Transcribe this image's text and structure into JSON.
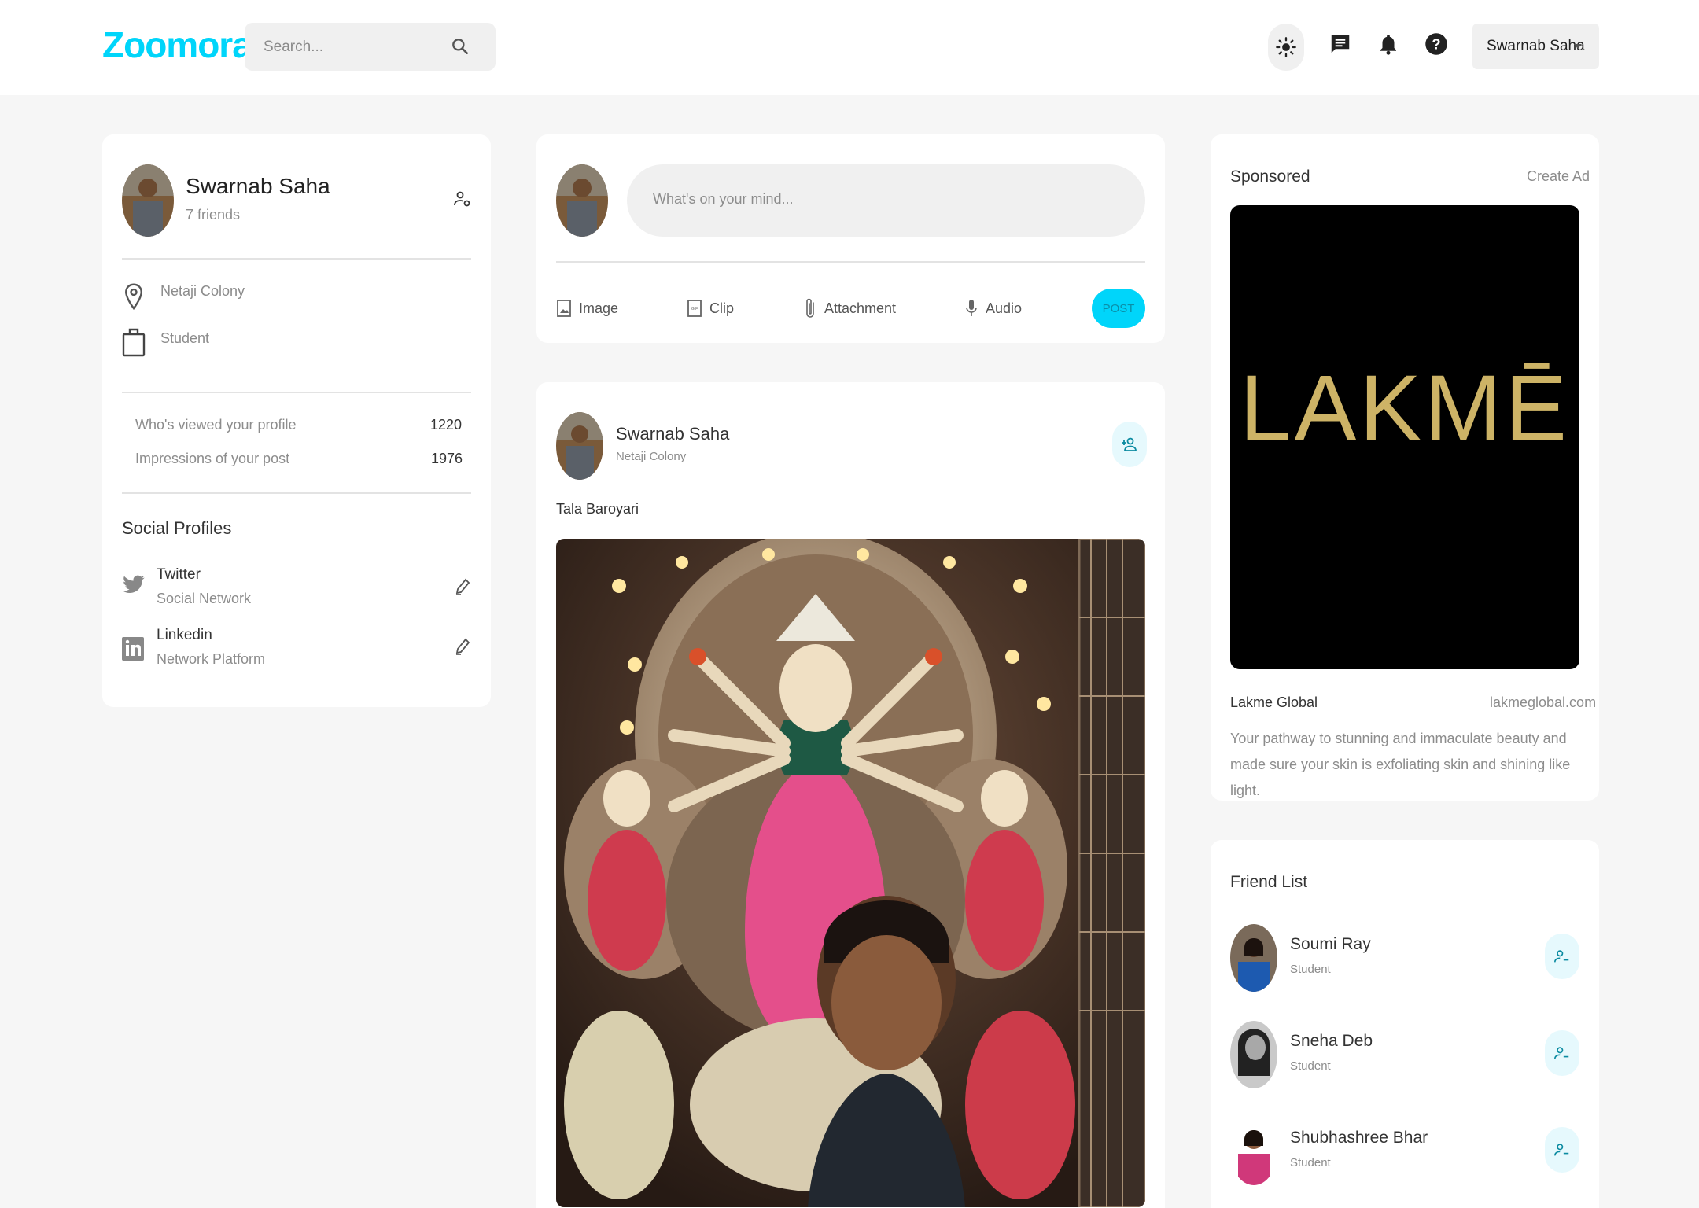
{
  "nav": {
    "logo": "Zoomora",
    "search_placeholder": "Search...",
    "user_name": "Swarnab Saha",
    "icons": [
      "search-icon",
      "light-mode-icon",
      "message-icon",
      "notification-icon",
      "help-icon",
      "chevron-down-icon"
    ]
  },
  "profile": {
    "name": "Swarnab Saha",
    "friends": "7 friends",
    "location": "Netaji Colony",
    "occupation": "Student",
    "stats": [
      {
        "label": "Who's viewed your profile",
        "value": "1220"
      },
      {
        "label": "Impressions of your post",
        "value": "1976"
      }
    ],
    "social_title": "Social Profiles",
    "socials": [
      {
        "name": "Twitter",
        "type": "Social Network",
        "icon": "twitter-icon"
      },
      {
        "name": "Linkedin",
        "type": "Network Platform",
        "icon": "linkedin-icon"
      }
    ]
  },
  "composer": {
    "placeholder": "What's on your mind...",
    "actions": [
      {
        "label": "Image",
        "icon": "image-icon"
      },
      {
        "label": "Clip",
        "icon": "gif-icon"
      },
      {
        "label": "Attachment",
        "icon": "attachment-icon"
      },
      {
        "label": "Audio",
        "icon": "microphone-icon"
      }
    ],
    "post_label": "POST"
  },
  "post": {
    "author": "Swarnab Saha",
    "location": "Netaji Colony",
    "caption": "Tala Baroyari"
  },
  "sponsored": {
    "title": "Sponsored",
    "create_ad": "Create Ad",
    "brand_logo_text": "LAKMĒ",
    "brand": "Lakme Global",
    "url": "lakmeglobal.com",
    "description": "Your pathway to stunning and immaculate beauty and made sure your skin is exfoliating skin and shining like light."
  },
  "friends": {
    "title": "Friend List",
    "items": [
      {
        "name": "Soumi Ray",
        "occupation": "Student"
      },
      {
        "name": "Sneha Deb",
        "occupation": "Student"
      },
      {
        "name": "Shubhashree Bhar",
        "occupation": "Student"
      }
    ]
  },
  "colors": {
    "accent": "#00d5fa",
    "background": "#f6f6f6",
    "card": "#ffffff"
  }
}
